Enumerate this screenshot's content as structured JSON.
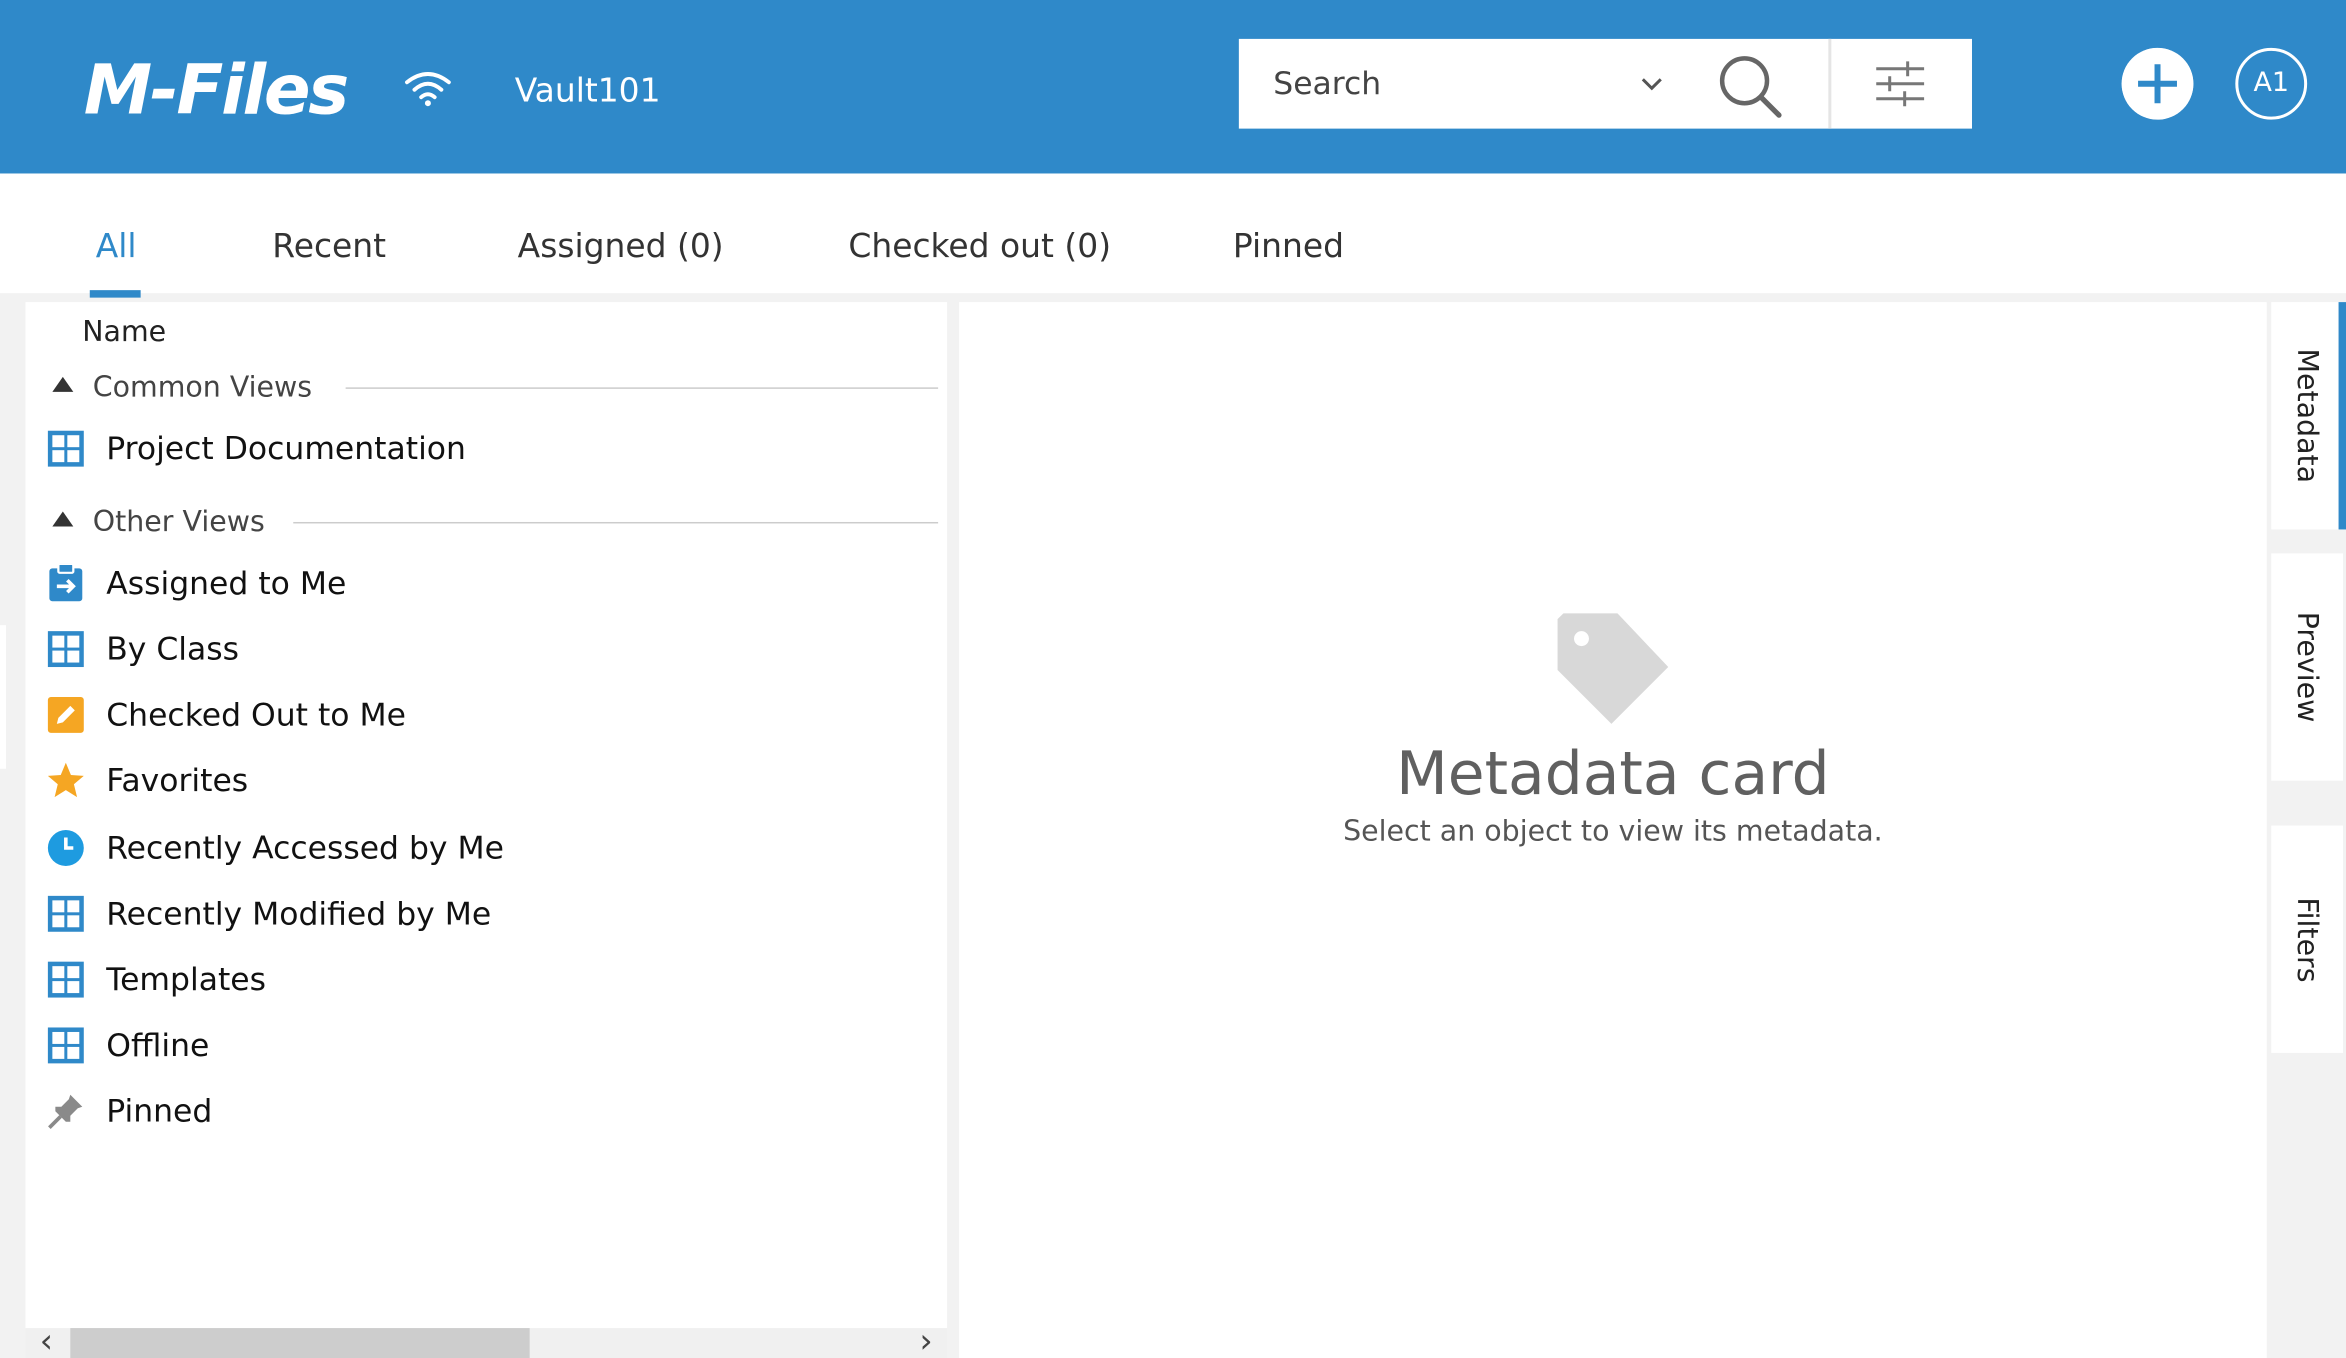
{
  "header": {
    "logo": "M-Files",
    "vault_name": "Vault101",
    "search": {
      "placeholder": "Search"
    },
    "avatar_initials": "A1",
    "brand_color": "#2f89c9"
  },
  "tabs": [
    {
      "label": "All",
      "active": true
    },
    {
      "label": "Recent"
    },
    {
      "label": "Assigned (0)"
    },
    {
      "label": "Checked out (0)"
    },
    {
      "label": "Pinned"
    }
  ],
  "list": {
    "column_name": "Name",
    "groups": [
      {
        "label": "Common Views",
        "items": [
          {
            "label": "Project Documentation",
            "icon": "view-grid-icon"
          }
        ]
      },
      {
        "label": "Other Views",
        "items": [
          {
            "label": "Assigned to Me",
            "icon": "assignment-icon"
          },
          {
            "label": "By Class",
            "icon": "view-grid-icon"
          },
          {
            "label": "Checked Out to Me",
            "icon": "checked-out-icon"
          },
          {
            "label": "Favorites",
            "icon": "star-icon"
          },
          {
            "label": "Recently Accessed by Me",
            "icon": "clock-icon"
          },
          {
            "label": "Recently Modified by Me",
            "icon": "view-grid-icon"
          },
          {
            "label": "Templates",
            "icon": "view-grid-icon"
          },
          {
            "label": "Offline",
            "icon": "view-grid-icon"
          },
          {
            "label": "Pinned",
            "icon": "pin-icon"
          }
        ]
      }
    ]
  },
  "metadata_card": {
    "title": "Metadata card",
    "subtitle": "Select an object to view its metadata."
  },
  "right_tabs": [
    {
      "label": "Metadata",
      "active": true
    },
    {
      "label": "Preview"
    },
    {
      "label": "Filters"
    }
  ]
}
